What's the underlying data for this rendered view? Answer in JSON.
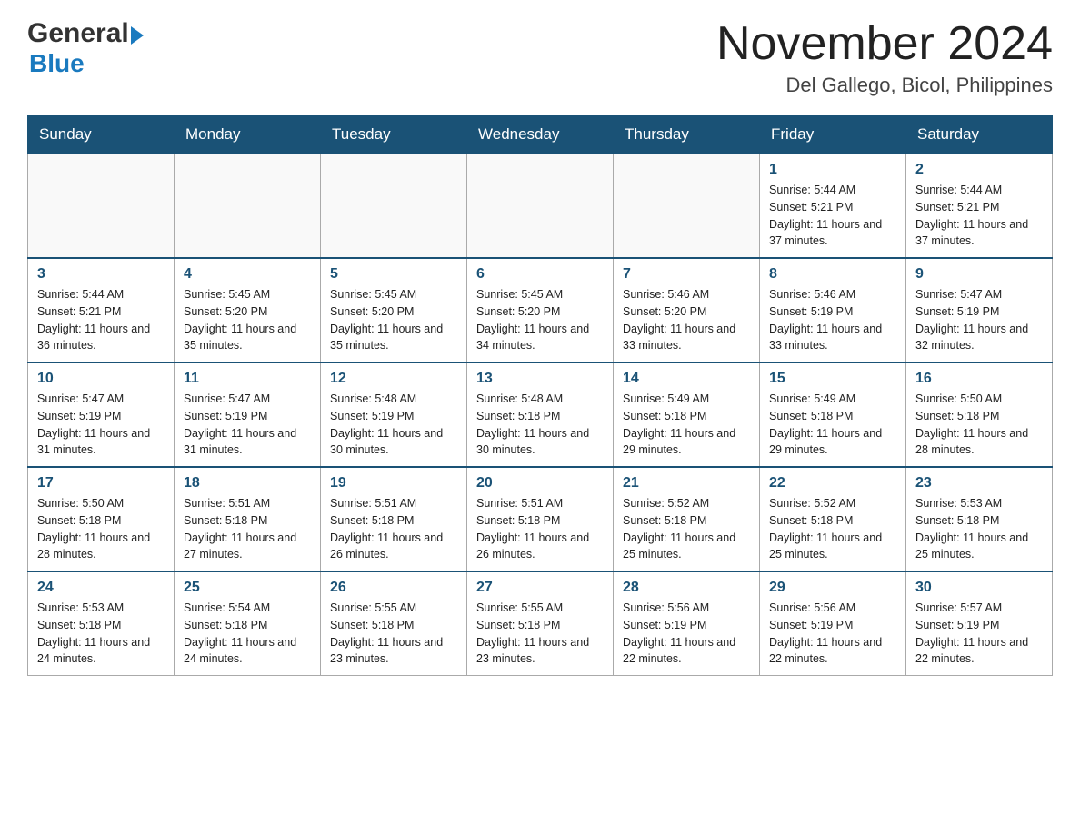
{
  "header": {
    "logo_general": "General",
    "logo_blue": "Blue",
    "month_title": "November 2024",
    "location": "Del Gallego, Bicol, Philippines"
  },
  "days_of_week": [
    "Sunday",
    "Monday",
    "Tuesday",
    "Wednesday",
    "Thursday",
    "Friday",
    "Saturday"
  ],
  "weeks": [
    {
      "days": [
        {
          "number": "",
          "sunrise": "",
          "sunset": "",
          "daylight": "",
          "empty": true
        },
        {
          "number": "",
          "sunrise": "",
          "sunset": "",
          "daylight": "",
          "empty": true
        },
        {
          "number": "",
          "sunrise": "",
          "sunset": "",
          "daylight": "",
          "empty": true
        },
        {
          "number": "",
          "sunrise": "",
          "sunset": "",
          "daylight": "",
          "empty": true
        },
        {
          "number": "",
          "sunrise": "",
          "sunset": "",
          "daylight": "",
          "empty": true
        },
        {
          "number": "1",
          "sunrise": "Sunrise: 5:44 AM",
          "sunset": "Sunset: 5:21 PM",
          "daylight": "Daylight: 11 hours and 37 minutes."
        },
        {
          "number": "2",
          "sunrise": "Sunrise: 5:44 AM",
          "sunset": "Sunset: 5:21 PM",
          "daylight": "Daylight: 11 hours and 37 minutes."
        }
      ]
    },
    {
      "days": [
        {
          "number": "3",
          "sunrise": "Sunrise: 5:44 AM",
          "sunset": "Sunset: 5:21 PM",
          "daylight": "Daylight: 11 hours and 36 minutes."
        },
        {
          "number": "4",
          "sunrise": "Sunrise: 5:45 AM",
          "sunset": "Sunset: 5:20 PM",
          "daylight": "Daylight: 11 hours and 35 minutes."
        },
        {
          "number": "5",
          "sunrise": "Sunrise: 5:45 AM",
          "sunset": "Sunset: 5:20 PM",
          "daylight": "Daylight: 11 hours and 35 minutes."
        },
        {
          "number": "6",
          "sunrise": "Sunrise: 5:45 AM",
          "sunset": "Sunset: 5:20 PM",
          "daylight": "Daylight: 11 hours and 34 minutes."
        },
        {
          "number": "7",
          "sunrise": "Sunrise: 5:46 AM",
          "sunset": "Sunset: 5:20 PM",
          "daylight": "Daylight: 11 hours and 33 minutes."
        },
        {
          "number": "8",
          "sunrise": "Sunrise: 5:46 AM",
          "sunset": "Sunset: 5:19 PM",
          "daylight": "Daylight: 11 hours and 33 minutes."
        },
        {
          "number": "9",
          "sunrise": "Sunrise: 5:47 AM",
          "sunset": "Sunset: 5:19 PM",
          "daylight": "Daylight: 11 hours and 32 minutes."
        }
      ]
    },
    {
      "days": [
        {
          "number": "10",
          "sunrise": "Sunrise: 5:47 AM",
          "sunset": "Sunset: 5:19 PM",
          "daylight": "Daylight: 11 hours and 31 minutes."
        },
        {
          "number": "11",
          "sunrise": "Sunrise: 5:47 AM",
          "sunset": "Sunset: 5:19 PM",
          "daylight": "Daylight: 11 hours and 31 minutes."
        },
        {
          "number": "12",
          "sunrise": "Sunrise: 5:48 AM",
          "sunset": "Sunset: 5:19 PM",
          "daylight": "Daylight: 11 hours and 30 minutes."
        },
        {
          "number": "13",
          "sunrise": "Sunrise: 5:48 AM",
          "sunset": "Sunset: 5:18 PM",
          "daylight": "Daylight: 11 hours and 30 minutes."
        },
        {
          "number": "14",
          "sunrise": "Sunrise: 5:49 AM",
          "sunset": "Sunset: 5:18 PM",
          "daylight": "Daylight: 11 hours and 29 minutes."
        },
        {
          "number": "15",
          "sunrise": "Sunrise: 5:49 AM",
          "sunset": "Sunset: 5:18 PM",
          "daylight": "Daylight: 11 hours and 29 minutes."
        },
        {
          "number": "16",
          "sunrise": "Sunrise: 5:50 AM",
          "sunset": "Sunset: 5:18 PM",
          "daylight": "Daylight: 11 hours and 28 minutes."
        }
      ]
    },
    {
      "days": [
        {
          "number": "17",
          "sunrise": "Sunrise: 5:50 AM",
          "sunset": "Sunset: 5:18 PM",
          "daylight": "Daylight: 11 hours and 28 minutes."
        },
        {
          "number": "18",
          "sunrise": "Sunrise: 5:51 AM",
          "sunset": "Sunset: 5:18 PM",
          "daylight": "Daylight: 11 hours and 27 minutes."
        },
        {
          "number": "19",
          "sunrise": "Sunrise: 5:51 AM",
          "sunset": "Sunset: 5:18 PM",
          "daylight": "Daylight: 11 hours and 26 minutes."
        },
        {
          "number": "20",
          "sunrise": "Sunrise: 5:51 AM",
          "sunset": "Sunset: 5:18 PM",
          "daylight": "Daylight: 11 hours and 26 minutes."
        },
        {
          "number": "21",
          "sunrise": "Sunrise: 5:52 AM",
          "sunset": "Sunset: 5:18 PM",
          "daylight": "Daylight: 11 hours and 25 minutes."
        },
        {
          "number": "22",
          "sunrise": "Sunrise: 5:52 AM",
          "sunset": "Sunset: 5:18 PM",
          "daylight": "Daylight: 11 hours and 25 minutes."
        },
        {
          "number": "23",
          "sunrise": "Sunrise: 5:53 AM",
          "sunset": "Sunset: 5:18 PM",
          "daylight": "Daylight: 11 hours and 25 minutes."
        }
      ]
    },
    {
      "days": [
        {
          "number": "24",
          "sunrise": "Sunrise: 5:53 AM",
          "sunset": "Sunset: 5:18 PM",
          "daylight": "Daylight: 11 hours and 24 minutes."
        },
        {
          "number": "25",
          "sunrise": "Sunrise: 5:54 AM",
          "sunset": "Sunset: 5:18 PM",
          "daylight": "Daylight: 11 hours and 24 minutes."
        },
        {
          "number": "26",
          "sunrise": "Sunrise: 5:55 AM",
          "sunset": "Sunset: 5:18 PM",
          "daylight": "Daylight: 11 hours and 23 minutes."
        },
        {
          "number": "27",
          "sunrise": "Sunrise: 5:55 AM",
          "sunset": "Sunset: 5:18 PM",
          "daylight": "Daylight: 11 hours and 23 minutes."
        },
        {
          "number": "28",
          "sunrise": "Sunrise: 5:56 AM",
          "sunset": "Sunset: 5:19 PM",
          "daylight": "Daylight: 11 hours and 22 minutes."
        },
        {
          "number": "29",
          "sunrise": "Sunrise: 5:56 AM",
          "sunset": "Sunset: 5:19 PM",
          "daylight": "Daylight: 11 hours and 22 minutes."
        },
        {
          "number": "30",
          "sunrise": "Sunrise: 5:57 AM",
          "sunset": "Sunset: 5:19 PM",
          "daylight": "Daylight: 11 hours and 22 minutes."
        }
      ]
    }
  ]
}
